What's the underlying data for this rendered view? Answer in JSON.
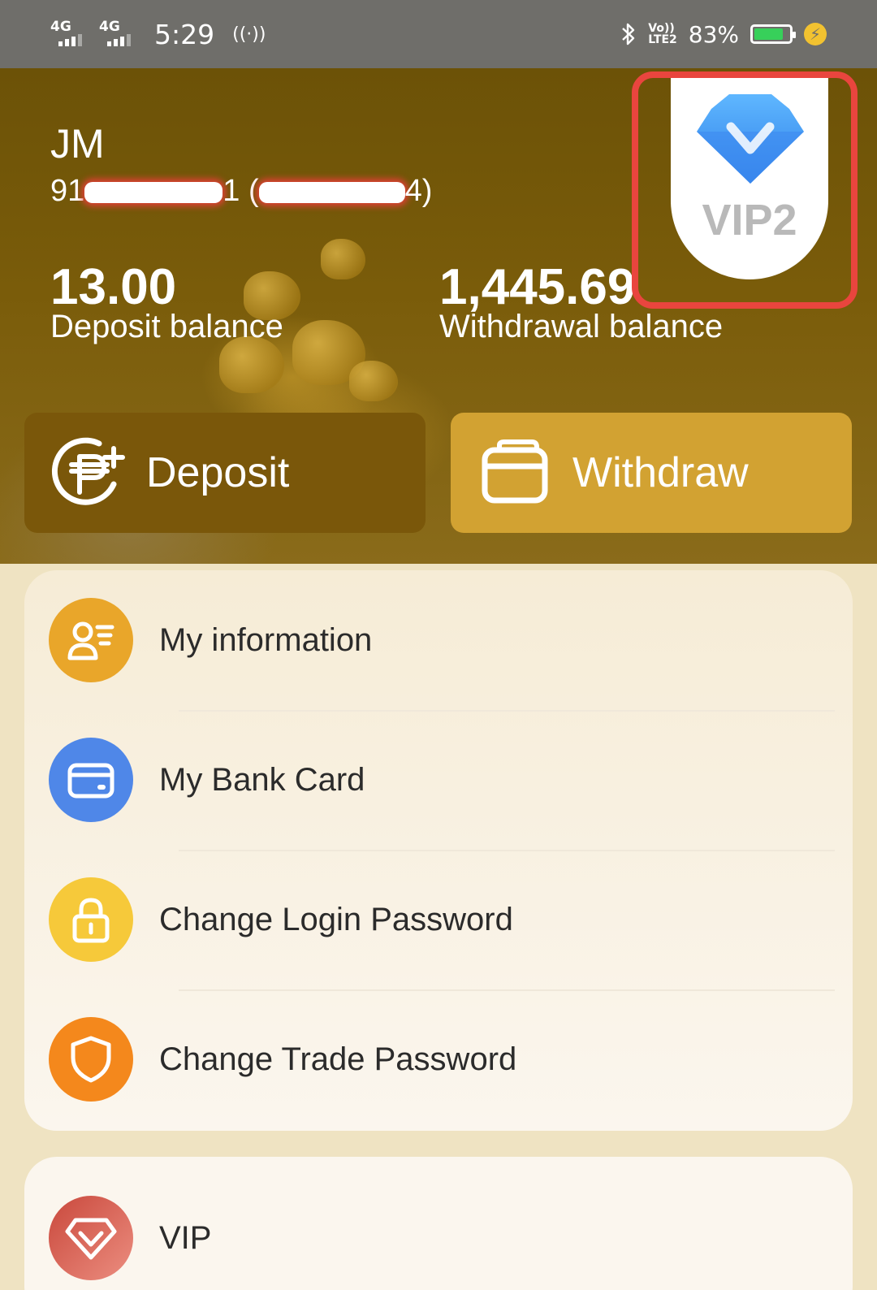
{
  "status_bar": {
    "net1": "4G",
    "net2": "4G",
    "time": "5:29",
    "hotspot_icon": "hotspot-icon",
    "bluetooth_icon": "bluetooth-icon",
    "volte_line1": "Vo))",
    "volte_line2": "LTE2",
    "battery_percent_text": "83%",
    "battery_level": 0.83,
    "battery_color": "#37d05a"
  },
  "profile": {
    "name": "JM",
    "phone_prefix": "91",
    "phone_suffix": "1",
    "id_open": "(",
    "id_close": "4)"
  },
  "balances": {
    "deposit_value": "13.00",
    "deposit_label": "Deposit balance",
    "withdrawal_value": "1,445.69",
    "withdrawal_label": "Withdrawal balance"
  },
  "vip_badge": {
    "level_text": "VIP2",
    "gem_icon": "diamond-v-icon",
    "highlight_color": "#e9453e"
  },
  "actions": {
    "deposit_label": "Deposit",
    "deposit_icon": "peso-plus-icon",
    "withdraw_label": "Withdraw",
    "withdraw_icon": "wallet-icon"
  },
  "menu": {
    "items": [
      {
        "label": "My information",
        "icon": "user-info-icon",
        "color": "#e9a62a"
      },
      {
        "label": "My Bank Card",
        "icon": "bank-card-icon",
        "color": "#4f87e8"
      },
      {
        "label": "Change Login Password",
        "icon": "lock-icon",
        "color": "#f6c93a"
      },
      {
        "label": "Change Trade Password",
        "icon": "shield-icon",
        "color": "#f4881c"
      }
    ],
    "vip_item": {
      "label": "VIP",
      "icon": "diamond-icon",
      "color": "#d9574a"
    }
  },
  "colors": {
    "header_brown": "#7a570a",
    "withdraw_gold": "#d2a232"
  }
}
